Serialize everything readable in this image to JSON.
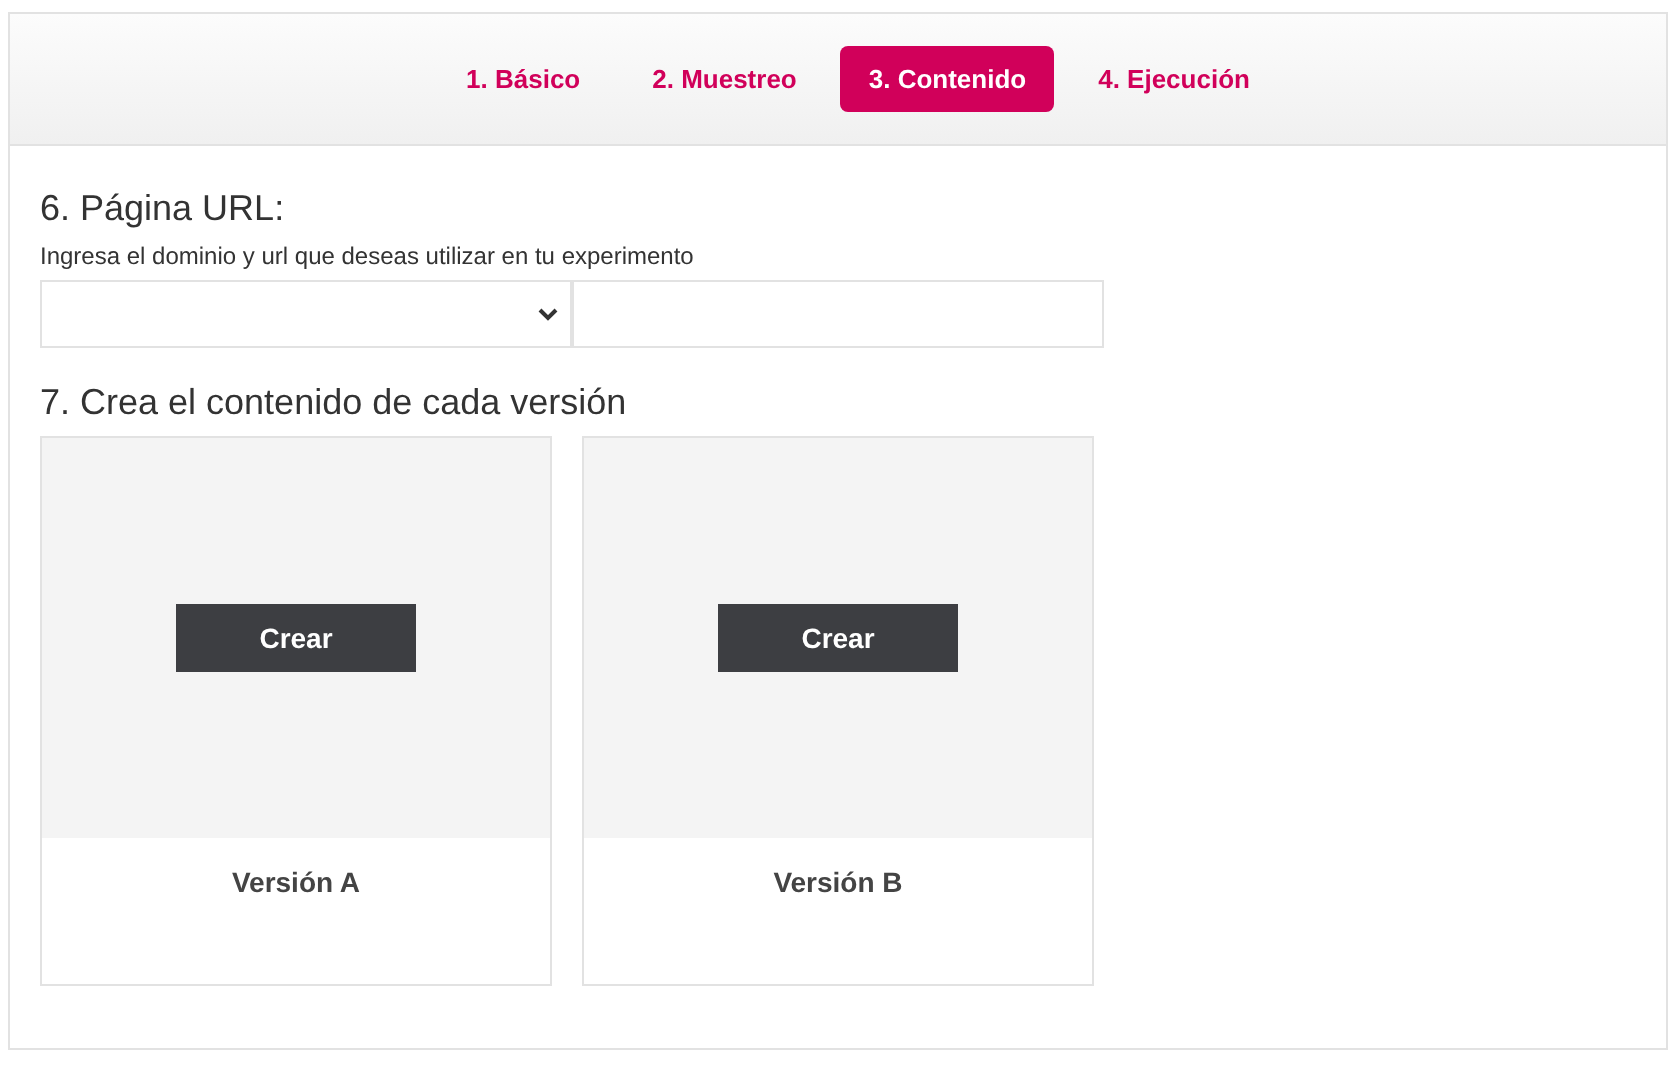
{
  "tabs": [
    {
      "label": "1. Básico",
      "selected": false
    },
    {
      "label": "2. Muestreo",
      "selected": false
    },
    {
      "label": "3. Contenido",
      "selected": true
    },
    {
      "label": "4. Ejecución",
      "selected": false
    }
  ],
  "url_section": {
    "title": "6. Página URL:",
    "hint": "Ingresa el dominio y url que deseas utilizar en tu experimento"
  },
  "content_section": {
    "title": "7. Crea el contenido de cada versión",
    "versions": [
      {
        "button": "Crear",
        "label": "Versión A"
      },
      {
        "button": "Crear",
        "label": "Versión B"
      }
    ]
  }
}
